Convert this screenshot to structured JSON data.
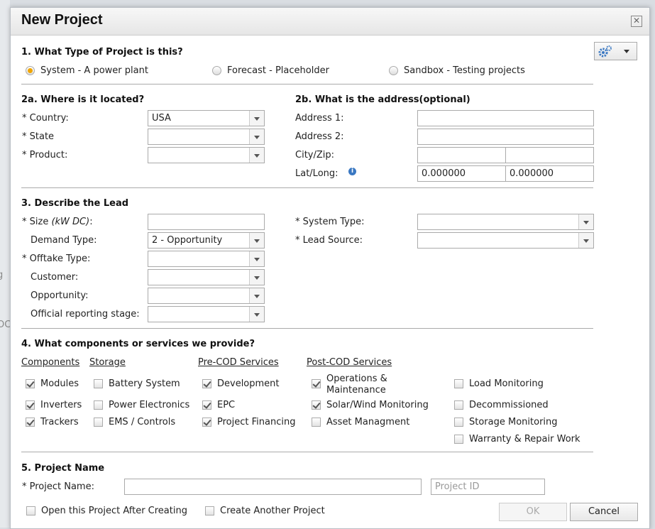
{
  "background": {
    "left_fragments": [
      "g",
      "OC"
    ]
  },
  "dialog": {
    "title": "New Project",
    "close": "✕"
  },
  "section1": {
    "title": "1. What Type of Project is this?",
    "options": [
      {
        "label": "System - A power plant",
        "selected": true
      },
      {
        "label": "Forecast - Placeholder",
        "selected": false
      },
      {
        "label": "Sandbox - Testing projects",
        "selected": false
      }
    ]
  },
  "section2a": {
    "title": "2a. Where is it located?",
    "country_label": "* Country:",
    "country_value": "USA",
    "state_label": "* State",
    "state_value": "",
    "product_label": "* Product:",
    "product_value": ""
  },
  "section2b": {
    "title": "2b. What is the address(optional)",
    "address1_label": "Address 1:",
    "address2_label": "Address 2:",
    "cityzip_label": "City/Zip:",
    "latlong_label": "Lat/Long:",
    "lat_value": "0.000000",
    "long_value": "0.000000"
  },
  "section3": {
    "title": "3. Describe the Lead",
    "size_label_pre": "* Size ",
    "size_label_unit": "(kW DC)",
    "size_label_post": ":",
    "demand_label": "Demand Type:",
    "demand_value": "2 - Opportunity",
    "offtake_label": "* Offtake Type:",
    "customer_label": "Customer:",
    "opportunity_label": "Opportunity:",
    "reporting_label": "Official reporting stage:",
    "system_type_label": "* System Type:",
    "lead_source_label": "* Lead Source:"
  },
  "section4": {
    "title": "4. What components or services we provide?",
    "headers": {
      "components": "Components",
      "storage": "Storage",
      "precod": "Pre-COD Services",
      "postcod": "Post-COD Services"
    },
    "components": [
      {
        "label": "Modules",
        "checked": true
      },
      {
        "label": "Inverters",
        "checked": true
      },
      {
        "label": "Trackers",
        "checked": true
      }
    ],
    "storage": [
      {
        "label": "Battery System",
        "checked": false
      },
      {
        "label": "Power Electronics",
        "checked": false
      },
      {
        "label": "EMS / Controls",
        "checked": false
      }
    ],
    "precod": [
      {
        "label": "Development",
        "checked": true
      },
      {
        "label": "EPC",
        "checked": true
      },
      {
        "label": "Project Financing",
        "checked": true
      }
    ],
    "postcod": [
      {
        "label": "Operations &",
        "label2": "Maintenance",
        "checked": true
      },
      {
        "label": "Solar/Wind Monitoring",
        "checked": true
      },
      {
        "label": "Asset Managment",
        "checked": false
      }
    ],
    "other": [
      {
        "label": "Load Monitoring",
        "checked": false
      },
      {
        "label": "Decommissioned",
        "checked": false
      },
      {
        "label": "Storage Monitoring",
        "checked": false
      },
      {
        "label": "Warranty & Repair Work",
        "checked": false
      }
    ]
  },
  "section5": {
    "title": "5. Project Name",
    "name_label": "* Project Name:",
    "project_id_placeholder": "Project ID"
  },
  "footer": {
    "open_after": "Open this Project After Creating",
    "create_another": "Create Another Project",
    "ok": "OK",
    "cancel": "Cancel"
  },
  "colors": {
    "accent_radio": "#f0a500",
    "gear": "#3a78c2"
  }
}
